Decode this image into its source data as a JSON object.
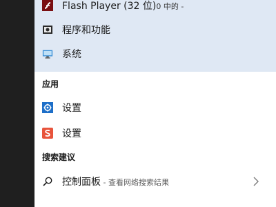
{
  "best_match": {
    "items": [
      {
        "label": "Flash Player (32 位)",
        "sublabel": "0 中的 -",
        "icon": "flash-player-icon"
      },
      {
        "label": "程序和功能",
        "icon": "programs-features-icon"
      },
      {
        "label": "系统",
        "icon": "system-monitor-icon"
      }
    ]
  },
  "apps": {
    "header": "应用",
    "items": [
      {
        "label": "设置",
        "icon": "settings-gear-icon"
      },
      {
        "label": "设置",
        "icon": "sogou-settings-icon"
      }
    ]
  },
  "search_suggestions": {
    "header": "搜索建议",
    "items": [
      {
        "label": "控制面板",
        "hint": " - 查看网络搜索结果",
        "icon": "search-icon",
        "chevron": "chevron-right-icon"
      }
    ]
  },
  "colors": {
    "best_match_bg": "#dfe8f4",
    "taskbar_bg": "#1f1f1f",
    "settings_blue": "#1e6fc8",
    "sogou_red": "#e8543c",
    "flash_red": "#7a0f12"
  }
}
